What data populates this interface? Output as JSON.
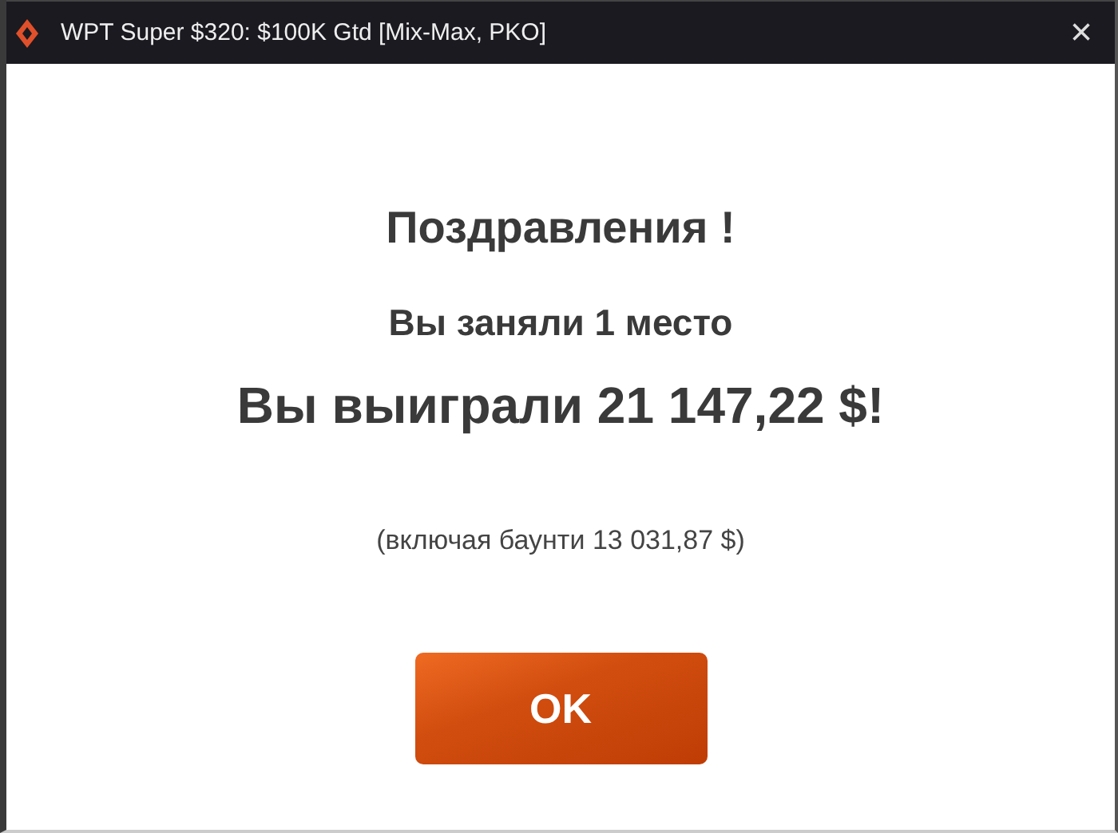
{
  "window": {
    "title": "WPT Super $320: $100K Gtd [Mix-Max, PKO]",
    "close": "×"
  },
  "heading": "Поздравления !",
  "place": "Вы заняли 1 место",
  "winnings": "Вы выиграли 21 147,22 $!",
  "bounty_note": "(включая баунти 13 031,87 $)",
  "buttons": [
    "OK"
  ]
}
